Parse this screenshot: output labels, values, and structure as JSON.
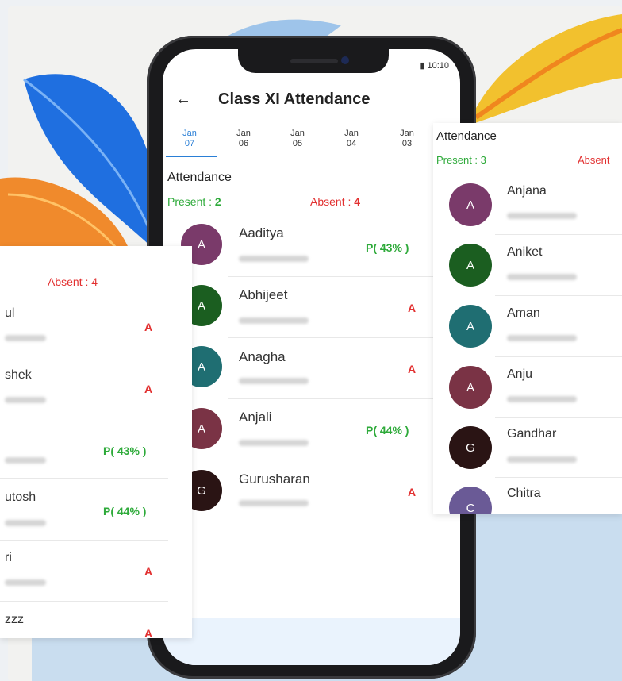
{
  "phone": {
    "status_time": "10:10",
    "title": "Class XI Attendance",
    "back_icon": "arrow-left-icon",
    "tabs": [
      {
        "month": "Jan",
        "day": "07",
        "active": true
      },
      {
        "month": "Jan",
        "day": "06",
        "active": false
      },
      {
        "month": "Jan",
        "day": "05",
        "active": false
      },
      {
        "month": "Jan",
        "day": "04",
        "active": false
      },
      {
        "month": "Jan",
        "day": "03",
        "active": false
      }
    ],
    "section_title": "Attendance",
    "present_label": "Present : ",
    "present_count": "2",
    "absent_label": "Absent : ",
    "absent_count": "4",
    "students": [
      {
        "initial": "A",
        "name": "Aaditya",
        "mark": "P( 43% )",
        "color": "#7a3a6a"
      },
      {
        "initial": "A",
        "name": "Abhijeet",
        "mark": "A",
        "color": "#1b5e20"
      },
      {
        "initial": "A",
        "name": "Anagha",
        "mark": "A",
        "color": "#1f6e72"
      },
      {
        "initial": "A",
        "name": "Anjali",
        "mark": "P( 44% )",
        "color": "#7a3345"
      },
      {
        "initial": "G",
        "name": "Gurusharan",
        "mark": "A",
        "color": "#2a1414"
      }
    ]
  },
  "left_card": {
    "absent_text": "Absent : 4",
    "rows": [
      {
        "name": "ul",
        "mark": "A"
      },
      {
        "name": "shek",
        "mark": "A"
      },
      {
        "name": "",
        "mark": "P( 43% )"
      },
      {
        "name": "utosh",
        "mark": "P( 44% )"
      },
      {
        "name": "ri",
        "mark": "A"
      },
      {
        "name": "zzz",
        "mark": "A"
      }
    ]
  },
  "right_card": {
    "section_title": "Attendance",
    "present_text": "Present : 3",
    "absent_text": "Absent",
    "students": [
      {
        "initial": "A",
        "name": "Anjana",
        "color": "#7a3a6a"
      },
      {
        "initial": "A",
        "name": "Aniket",
        "color": "#1b5e20"
      },
      {
        "initial": "A",
        "name": "Aman",
        "color": "#1f6e72"
      },
      {
        "initial": "A",
        "name": "Anju",
        "color": "#7a3345"
      },
      {
        "initial": "G",
        "name": "Gandhar",
        "color": "#2a1414"
      },
      {
        "initial": "C",
        "name": "Chitra",
        "color": "#6a5a96"
      }
    ]
  },
  "colors": {
    "accent_blue": "#2a7fd6",
    "present_green": "#2eaa3a",
    "absent_red": "#e23030"
  }
}
